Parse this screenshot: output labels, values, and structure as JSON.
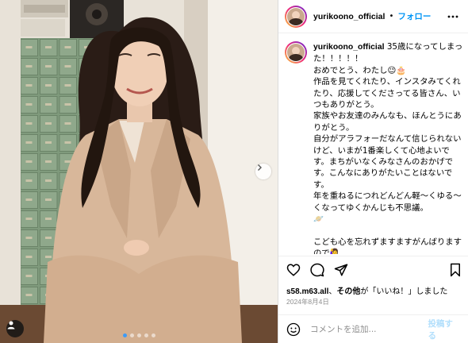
{
  "post": {
    "username": "yurikoono_official",
    "separator": "•",
    "follow_label": "フォロー",
    "caption": "35歳になってしまった！！！！！\nおめでとう、わたし😉🎂\n作品を見てくれたり、インスタみてくれたり、応援してくださってる皆さん、いつもありがとう。\n家族やお友達のみんなも、ほんとうにありがとう。\n自分がアラフォーだなんて信じられないけど、いまが1番楽しくて心地よいです。まちがいなくみなさんのおかげです。こんなにありがたいことはないです。\n年を重ねるにつれどんどん軽〜くゆる〜くなってゆくかんじも不思議。\n🪐\n\nこども心を忘れずますますがんばりますので🙋‍♀️\nこれからもどうかよろしくお願いします",
    "likes_user": "s58.m63.all",
    "likes_connector": "、",
    "likes_others": "その他",
    "likes_suffix": "が「いいね！」しました",
    "date": "2024年8月4日"
  },
  "comment": {
    "placeholder": "コメントを追加...",
    "post_label": "投稿する"
  },
  "carousel": {
    "count": 5,
    "active": 1
  },
  "icons": {
    "like": "heart-icon",
    "comment": "comment-icon",
    "share": "paper-plane-icon",
    "save": "bookmark-icon",
    "more": "more-options-icon",
    "emoji": "emoji-icon",
    "next": "chevron-right-icon",
    "user_tag": "user-tag-icon"
  },
  "colors": {
    "accent": "#0095f6",
    "post_disabled": "#b2dffc",
    "muted": "#8e8e8e"
  }
}
